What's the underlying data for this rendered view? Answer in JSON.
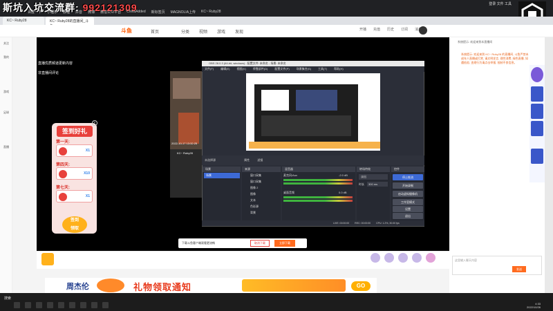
{
  "overlay": {
    "title": "斯坑入坑交流群",
    "number": "992121309"
  },
  "browser": {
    "bookmarks": [
      "百度一下",
      "小程序",
      "教程",
      "抖音",
      "微博",
      "微信公众平台",
      "ChinaAdded",
      "新标签页",
      "MAGNOLIA上传",
      "KC~ Ruby28"
    ],
    "window_controls": "登录 文件 工具",
    "tabs": [
      "KC~ Ruby28",
      "KC~ Ruby28的直播间_斗鱼..."
    ]
  },
  "site": {
    "logo": "斗鱼",
    "nav": [
      "首页",
      "分类",
      "视频",
      "游戏",
      "发现"
    ],
    "nav_right": [
      "开播",
      "充值",
      "历史",
      "订阅",
      "消息"
    ]
  },
  "left_sidebar": [
    "关注",
    "我的",
    "游戏",
    "足球",
    "直播"
  ],
  "player_text": [
    "直播优质频道更新内容",
    "非直播间评论"
  ],
  "signin": {
    "title": "签到好礼",
    "days": [
      "第一天:",
      "第四天:",
      "第七天:"
    ],
    "rewards": [
      "X1",
      "X10",
      "X1"
    ],
    "button": "签到\n领取",
    "close": "×"
  },
  "tile": {
    "date": "2022-10-17 13:32:25",
    "name": "KC~ Ruby28"
  },
  "obs": {
    "title": "OBS 28.0.3 (64-bit, windows) - 配置文件: 未命名 - 场景: 未命名",
    "menu": [
      "文件(F)",
      "编辑(E)",
      "视图(V)",
      "停靠部件(D)",
      "配置文件(P)",
      "场景集合(S)",
      "工具(T)",
      "帮助(H)"
    ],
    "attr_label": "未选择源",
    "attr_buttons": [
      "属性",
      "滤镜"
    ],
    "panels": [
      "场景",
      "来源",
      "混音器",
      "转场特效",
      "控件"
    ],
    "scene_selected": "场景",
    "sources": [
      "窗口采集",
      "窗口采集",
      "图像 2",
      "图像",
      "文本",
      "色彩源",
      "背景"
    ],
    "mixer": [
      {
        "name": "麦克风/Aux",
        "db": "-2.0 dB"
      },
      {
        "name": "桌面音频",
        "db": "0.0 dB"
      }
    ],
    "transition": {
      "name": "淡出",
      "duration_label": "时长",
      "duration": "300 ms"
    },
    "controls": [
      "停止推流",
      "开始录制",
      "启动虚拟摄像机",
      "工作室模式",
      "设置",
      "退出"
    ],
    "status": [
      "LIVE: 00:00:00",
      "REC: 00:00:00",
      "CPU: 1.2%, 30.00 fps"
    ]
  },
  "notify": {
    "text": "下载斗鱼客户端观看更流畅",
    "btn1": "取消下载",
    "btn2": "立即下载"
  },
  "ad": {
    "left": "周杰伦",
    "text": "礼物领取通知",
    "go": "GO"
  },
  "chat": {
    "header": "系统提示: 欢迎来到本直播间",
    "message": "系统提示: 欢迎来到 KC~ Ruby28 的直播间, 斗鱼严禁未成年人直播或打赏, 请文明发言, 理性消费, 绿色直播, 如遇低俗, 违规行为请点击举报, 抵制不良信息。",
    "input_placeholder": "这里输入聊天内容",
    "send": "发送"
  },
  "taskbar": {
    "search": "搜索",
    "time": "4:33",
    "date": "2022/10/26"
  }
}
